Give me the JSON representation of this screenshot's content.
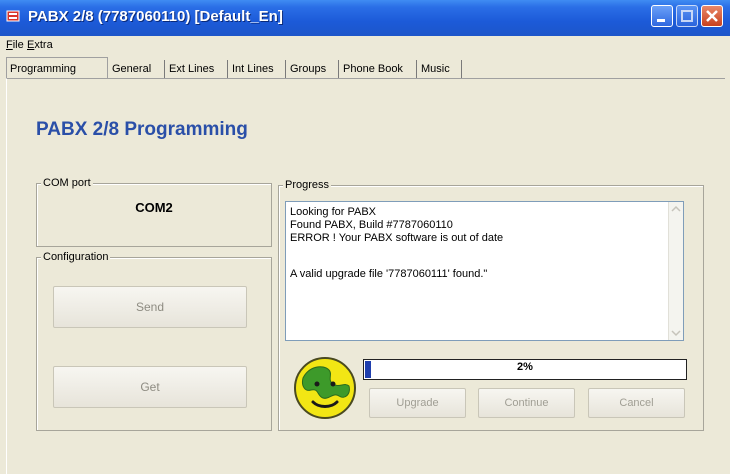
{
  "window": {
    "title": "PABX 2/8 (7787060110) [Default_En]"
  },
  "menu": [
    {
      "label_first": "F",
      "label_rest": "ile"
    },
    {
      "label_first": "E",
      "label_rest": "xtra"
    }
  ],
  "tabs": [
    {
      "label": "Programming",
      "active": true
    },
    {
      "label": "General",
      "active": false
    },
    {
      "label": "Ext Lines",
      "active": false
    },
    {
      "label": "Int Lines",
      "active": false
    },
    {
      "label": "Groups",
      "active": false
    },
    {
      "label": "Phone Book",
      "active": false
    },
    {
      "label": "Music",
      "active": false
    }
  ],
  "page_title": "PABX 2/8 Programming",
  "com_port": {
    "label": "COM port",
    "value": "COM2"
  },
  "configuration": {
    "label": "Configuration",
    "send_label": "Send",
    "get_label": "Get"
  },
  "progress": {
    "label": "Progress",
    "log": [
      "Looking for PABX",
      "Found PABX, Build #7787060110",
      "ERROR ! Your PABX software is out of date",
      "",
      "A valid upgrade file '7787060111' found.\""
    ],
    "percent": 2,
    "percent_text": "2%",
    "upgrade_label": "Upgrade",
    "continue_label": "Continue",
    "cancel_label": "Cancel"
  },
  "colors": {
    "title_blue": "#2a4fa8",
    "progress_fill": "#1f3fae"
  }
}
